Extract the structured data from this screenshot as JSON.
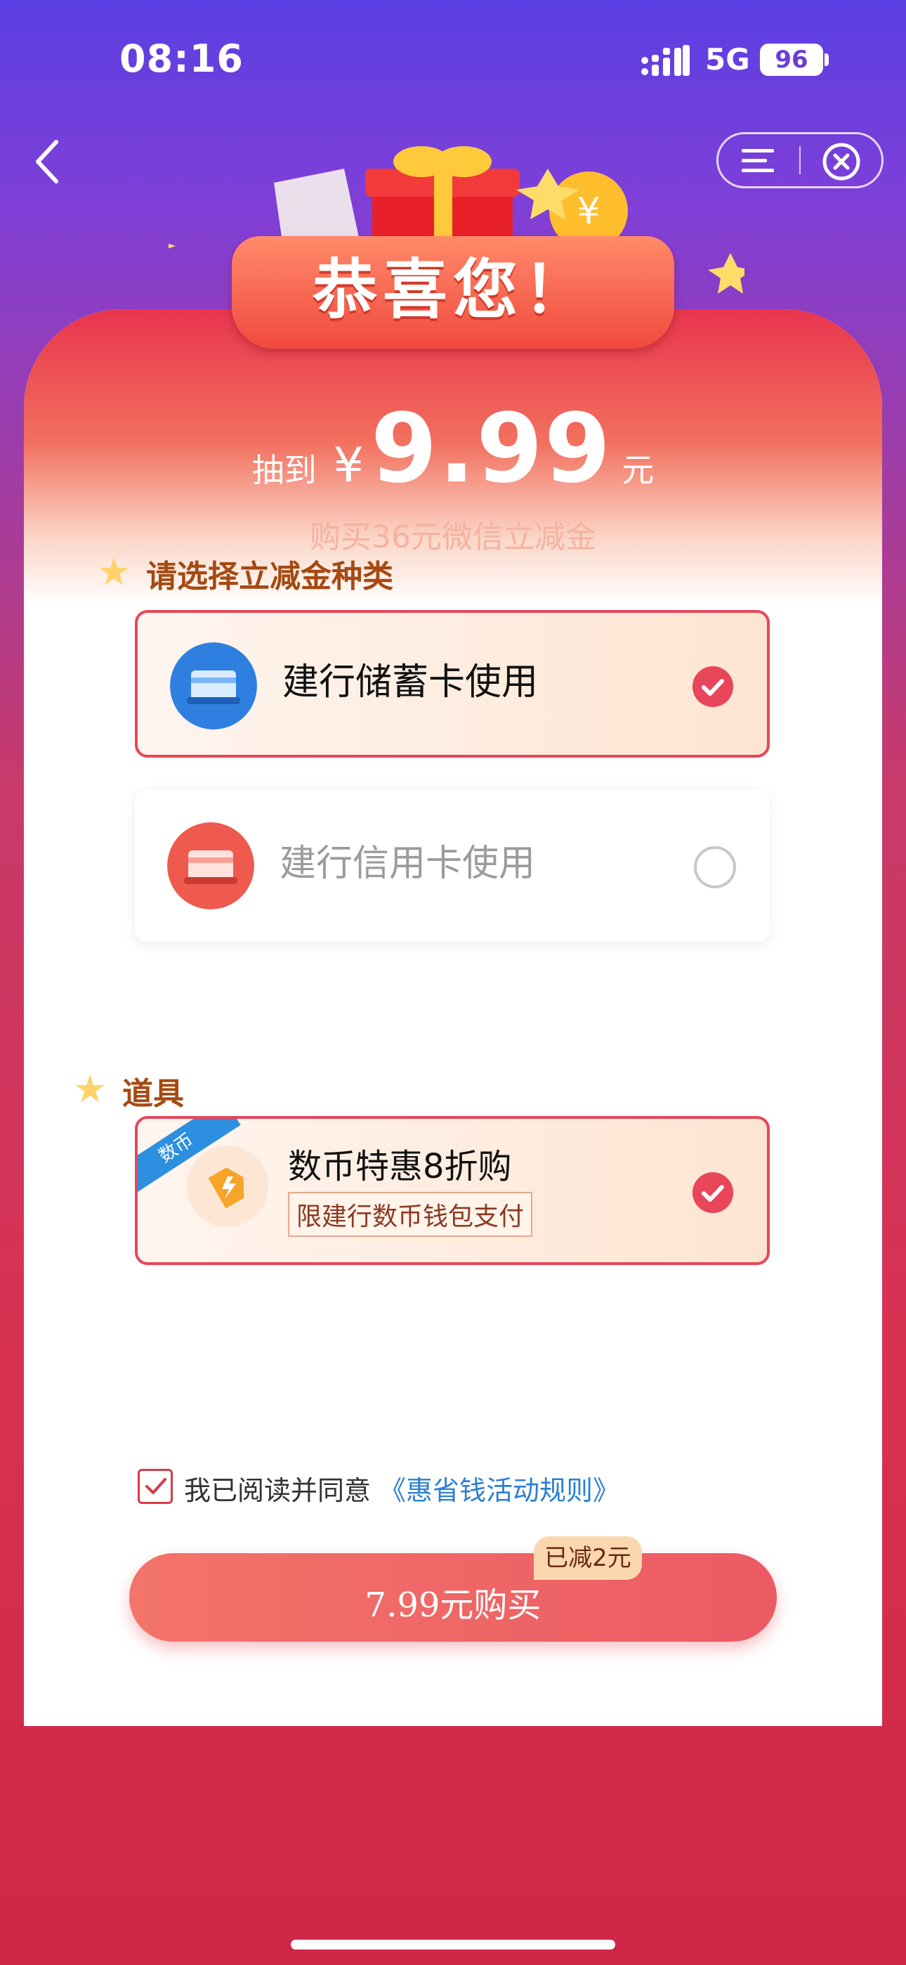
{
  "status_bar": {
    "time": "08:16",
    "network": "5G",
    "battery": "96"
  },
  "nav": {
    "back_icon": "chevron-left-icon",
    "menu_icon": "menu-icon",
    "close_icon": "close-circle-icon"
  },
  "banner": {
    "title": "恭喜您！"
  },
  "prize": {
    "prefix": "抽到",
    "currency": "¥",
    "amount": "9.99",
    "unit": "元",
    "description": "购买36元微信立减金"
  },
  "section_select": {
    "title": "请选择立减金种类"
  },
  "options": [
    {
      "label": "建行储蓄卡使用",
      "selected": true,
      "color": "#2f7fe0"
    },
    {
      "label": "建行信用卡使用",
      "selected": false,
      "color": "#ee5b4e"
    }
  ],
  "section_tools": {
    "title": "道具"
  },
  "tool": {
    "ribbon": "数币",
    "title": "数币特惠8折购",
    "subtitle": "限建行数币钱包支付",
    "selected": true
  },
  "agreement": {
    "text": "我已阅读并同意",
    "link": "《惠省钱活动规则》",
    "checked": true
  },
  "buy": {
    "label": "7.99元购买",
    "discount_badge": "已减2元"
  },
  "colors": {
    "accent": "#e8465a",
    "link": "#2a7fd4",
    "section_title": "#a54a12"
  }
}
